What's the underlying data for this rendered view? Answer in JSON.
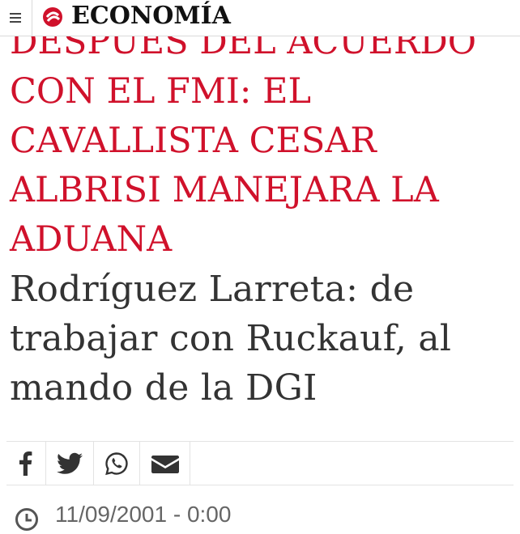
{
  "header": {
    "section_title": "ECONOMÍA",
    "menu_icon": "hamburger-menu-icon",
    "logo_icon": "newspaper-logo-icon",
    "brand_color": "#d0112b"
  },
  "article": {
    "kicker": "DESPUES DEL ACUERDO CON EL FMI: EL CAVALLISTA CESAR ALBRISI MANEJARA LA ADUANA",
    "title": "Rodríguez Larreta: de trabajar con Ruckauf, al mando de la DGI",
    "date": "11/09/2001 - 0:00"
  },
  "share": {
    "icons": [
      "facebook-icon",
      "twitter-icon",
      "whatsapp-icon",
      "email-icon"
    ]
  }
}
